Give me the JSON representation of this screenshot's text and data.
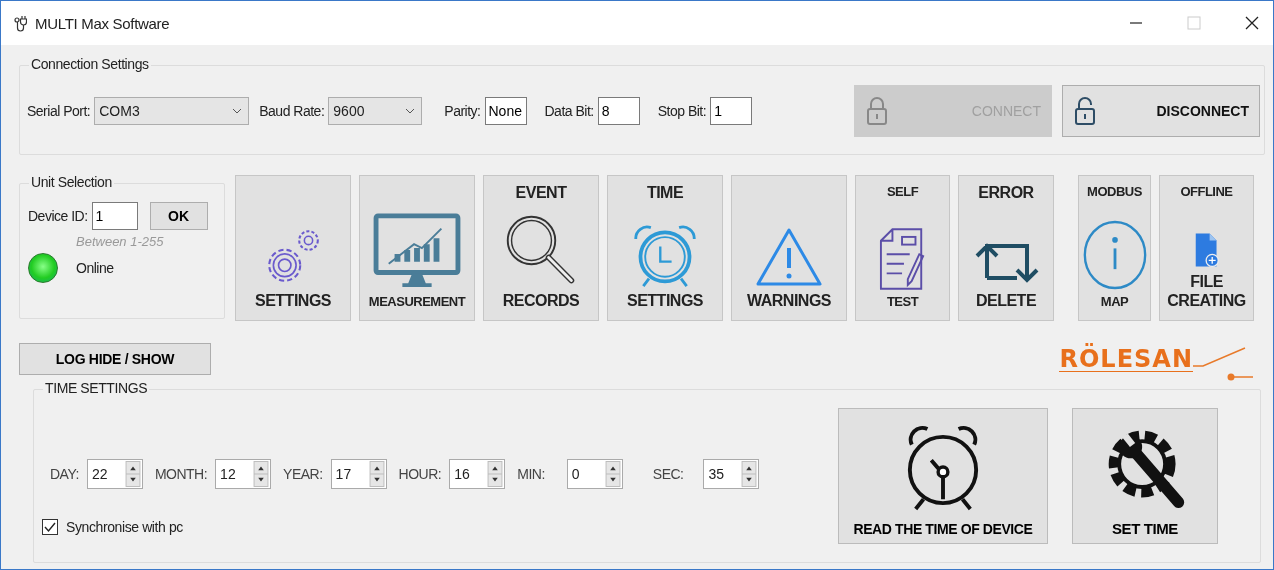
{
  "window": {
    "title": "MULTI Max Software"
  },
  "connection": {
    "title": "Connection Settings",
    "fields": [
      {
        "kind": "dropdown",
        "label": "Serial Port:",
        "value": "COM3"
      },
      {
        "kind": "dropdown",
        "label": "Baud Rate:",
        "value": "9600"
      },
      {
        "kind": "text",
        "label": "Parity:",
        "value": "None"
      },
      {
        "kind": "text",
        "label": "Data Bit:",
        "value": "8"
      },
      {
        "kind": "text",
        "label": "Stop Bit:",
        "value": "1"
      }
    ],
    "buttons": [
      {
        "kind": "locked",
        "label": "CONNECT",
        "disabled": true
      },
      {
        "kind": "unlocked",
        "label": "DISCONNECT",
        "disabled": false
      }
    ]
  },
  "unit_selection": {
    "title": "Unit Selection",
    "device_id_label": "Device ID:",
    "device_id": "1",
    "ok_button": "OK",
    "hint": "Between 1-255",
    "status": "Online",
    "online": true
  },
  "tools": [
    {
      "kind": "gears",
      "bottom": "SETTINGS"
    },
    {
      "kind": "monitor",
      "bottom": "MEASUREMENT"
    },
    {
      "kind": "magnifier",
      "top": "EVENT",
      "bottom": "RECORDS"
    },
    {
      "kind": "clock",
      "top": "TIME",
      "bottom": "SETTINGS"
    },
    {
      "kind": "warning",
      "bottom": "WARNINGS"
    },
    {
      "kind": "document",
      "top": "SELF",
      "bottom": "TEST"
    },
    {
      "kind": "swap",
      "top": "ERROR",
      "bottom": "DELETE"
    },
    {
      "kind": "info",
      "top": "MODBUS",
      "bottom": "MAP"
    },
    {
      "kind": "file",
      "top": "OFFLINE",
      "bottom": "FILE CREATING"
    }
  ],
  "log_button": "LOG HIDE / SHOW",
  "logo": "RÖLESAN",
  "time_settings": {
    "title": "TIME SETTINGS",
    "fields": [
      {
        "label": "DAY:",
        "value": "22"
      },
      {
        "label": "MONTH:",
        "value": "12"
      },
      {
        "label": "YEAR:",
        "value": "17"
      },
      {
        "label": "HOUR:",
        "value": "16"
      },
      {
        "label": "MIN:",
        "value": "0"
      },
      {
        "label": "SEC:",
        "value": "35"
      }
    ],
    "sync": {
      "label": "Synchronise with pc",
      "checked": true
    },
    "buttons": [
      {
        "kind": "clock",
        "label": "READ THE TIME OF DEVICE"
      },
      {
        "kind": "gear_wrench",
        "label": "SET TIME"
      }
    ]
  }
}
